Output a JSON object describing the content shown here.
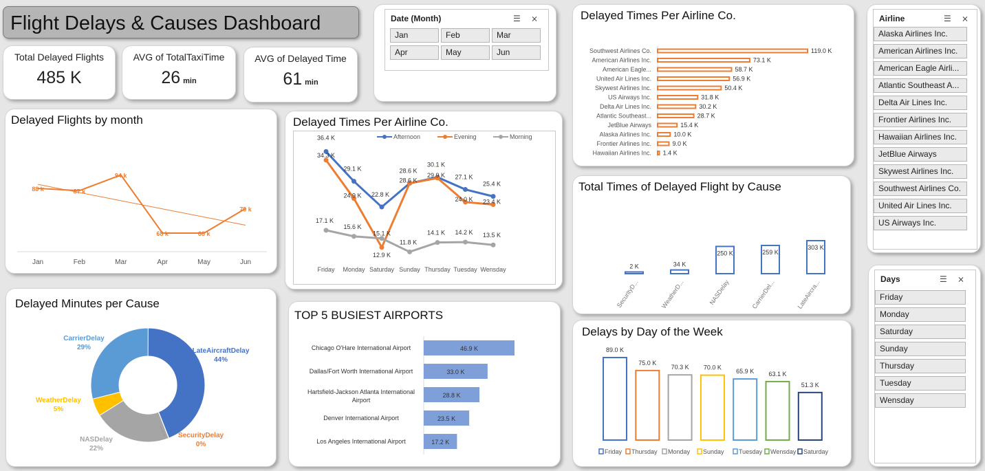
{
  "header": {
    "title": "Flight Delays & Causes Dashboard"
  },
  "kpis": [
    {
      "label": "Total Delayed Flights",
      "value": "485 K",
      "unit": ""
    },
    {
      "label": "AVG of TotalTaxiTime",
      "value": "26",
      "unit": "min"
    },
    {
      "label": "AVG of Delayed Time",
      "value": "61",
      "unit": "min"
    }
  ],
  "slicers": {
    "month": {
      "title": "Date (Month)",
      "items": [
        "Jan",
        "Feb",
        "Mar",
        "Apr",
        "May",
        "Jun"
      ]
    },
    "airline": {
      "title": "Airline",
      "items": [
        "Alaska Airlines Inc.",
        "American Airlines Inc.",
        "American Eagle Airli...",
        "Atlantic Southeast A...",
        "Delta Air Lines Inc.",
        "Frontier Airlines Inc.",
        "Hawaiian Airlines Inc.",
        "JetBlue Airways",
        "Skywest Airlines Inc.",
        "Southwest Airlines Co.",
        "United Air Lines Inc.",
        "US Airways Inc."
      ]
    },
    "days": {
      "title": "Days",
      "items": [
        "Friday",
        "Monday",
        "Saturday",
        "Sunday",
        "Thursday",
        "Tuesday",
        "Wensday"
      ]
    }
  },
  "chart_data": [
    {
      "id": "by_month",
      "type": "line",
      "title": "Delayed Flights by month",
      "categories": [
        "Jan",
        "Feb",
        "Mar",
        "Apr",
        "May",
        "Jun"
      ],
      "values": [
        88,
        87,
        94,
        68,
        68,
        79
      ],
      "labels": [
        "88 k",
        "87 k",
        "94 k",
        "68 k",
        "68 k",
        "79 k"
      ],
      "trendline": true,
      "color": "#ED7D31"
    },
    {
      "id": "airline_bar",
      "type": "bar",
      "title": "Delayed Times Per Airline Co.",
      "categories": [
        "Southwest Airlines Co.",
        "American Airlines Inc.",
        "American Eagle...",
        "United Air Lines Inc.",
        "Skywest Airlines Inc.",
        "US Airways Inc.",
        "Delta Air Lines Inc.",
        "Atlantic Southeast...",
        "JetBlue Airways",
        "Alaska Airlines Inc.",
        "Frontier Airlines Inc.",
        "Hawaiian Airlines Inc."
      ],
      "values": [
        119.0,
        73.1,
        58.7,
        56.9,
        50.4,
        31.8,
        30.2,
        28.7,
        15.4,
        10.0,
        9.0,
        1.4
      ],
      "labels": [
        "119.0 K",
        "73.1 K",
        "58.7 K",
        "56.9 K",
        "50.4 K",
        "31.8 K",
        "30.2 K",
        "28.7 K",
        "15.4 K",
        "10.0 K",
        "9.0 K",
        "1.4 K"
      ],
      "color": "#ED7D31"
    },
    {
      "id": "time_of_day",
      "type": "line",
      "title": "Delayed Times Per Airline Co.",
      "categories": [
        "Friday",
        "Monday",
        "Saturday",
        "Sunday",
        "Thursday",
        "Tuesday",
        "Wensday"
      ],
      "series": [
        {
          "name": "Afternoon",
          "color": "#4472C4",
          "values": [
            36.4,
            29.1,
            22.8,
            28.6,
            30.1,
            27.1,
            25.4
          ],
          "labels": [
            "36.4 K",
            "29.1 K",
            "22.8 K",
            "28.6 K",
            "30.1 K",
            "27.1 K",
            "25.4 K"
          ]
        },
        {
          "name": "Evening",
          "color": "#ED7D31",
          "values": [
            34.3,
            24.9,
            12.9,
            28.6,
            29.9,
            24.0,
            23.4
          ],
          "labels": [
            "34.3 K",
            "24.9 K",
            "12.9 K",
            "28.6 K",
            "29.9 K",
            "24.0 K",
            "23.4 K"
          ]
        },
        {
          "name": "Morning",
          "color": "#A5A5A5",
          "values": [
            17.1,
            15.6,
            15.1,
            11.8,
            14.1,
            14.2,
            13.5
          ],
          "labels": [
            "17.1 K",
            "15.6 K",
            "15.1 K",
            "11.8 K",
            "14.1 K",
            "14.2 K",
            "13.5 K"
          ]
        }
      ]
    },
    {
      "id": "by_cause",
      "type": "bar",
      "title": "Total Times of Delayed Flight by Cause",
      "categories": [
        "SecurityD...",
        "WeatherD...",
        "NASDelay",
        "CarrierDel...",
        "LateAircra..."
      ],
      "values": [
        2,
        34,
        250,
        259,
        303
      ],
      "labels": [
        "2 K",
        "34 K",
        "250 K",
        "259 K",
        "303 K"
      ],
      "color": "#4472C4"
    },
    {
      "id": "minutes_cause",
      "type": "pie",
      "title": "Delayed Minutes per Cause",
      "slices": [
        {
          "name": "LateAircraftDelay",
          "value": 44,
          "label": "44%",
          "color": "#4472C4"
        },
        {
          "name": "SecurityDelay",
          "value": 0,
          "label": "0%",
          "color": "#ED7D31"
        },
        {
          "name": "NASDelay",
          "value": 22,
          "label": "22%",
          "color": "#A5A5A5"
        },
        {
          "name": "WeatherDelay",
          "value": 5,
          "label": "5%",
          "color": "#FFC000"
        },
        {
          "name": "CarrierDelay",
          "value": 29,
          "label": "29%",
          "color": "#5B9BD5"
        }
      ]
    },
    {
      "id": "airports",
      "type": "bar",
      "title": "TOP 5 BUSIEST AIRPORTS",
      "categories": [
        "Chicago O'Hare International Airport",
        "Dallas/Fort Worth International Airport",
        "Hartsfield-Jackson Atlanta International Airport",
        "Denver International Airport",
        "Los Angeles International Airport"
      ],
      "values": [
        46.9,
        33.0,
        28.8,
        23.5,
        17.2
      ],
      "labels": [
        "46.9 K",
        "33.0 K",
        "28.8 K",
        "23.5 K",
        "17.2 K"
      ],
      "color": "#7F9FD9"
    },
    {
      "id": "day_week",
      "type": "bar",
      "title": "Delays by Day of the Week",
      "categories": [
        "Friday",
        "Thursday",
        "Monday",
        "Sunday",
        "Tuesday",
        "Wensday",
        "Saturday"
      ],
      "values": [
        89.0,
        75.0,
        70.3,
        70.0,
        65.9,
        63.1,
        51.3
      ],
      "labels": [
        "89.0 K",
        "75.0 K",
        "70.3 K",
        "70.0 K",
        "65.9 K",
        "63.1 K",
        "51.3 K"
      ],
      "colors": [
        "#4472C4",
        "#ED7D31",
        "#A5A5A5",
        "#FFC000",
        "#5B9BD5",
        "#70AD47",
        "#264478"
      ]
    }
  ]
}
